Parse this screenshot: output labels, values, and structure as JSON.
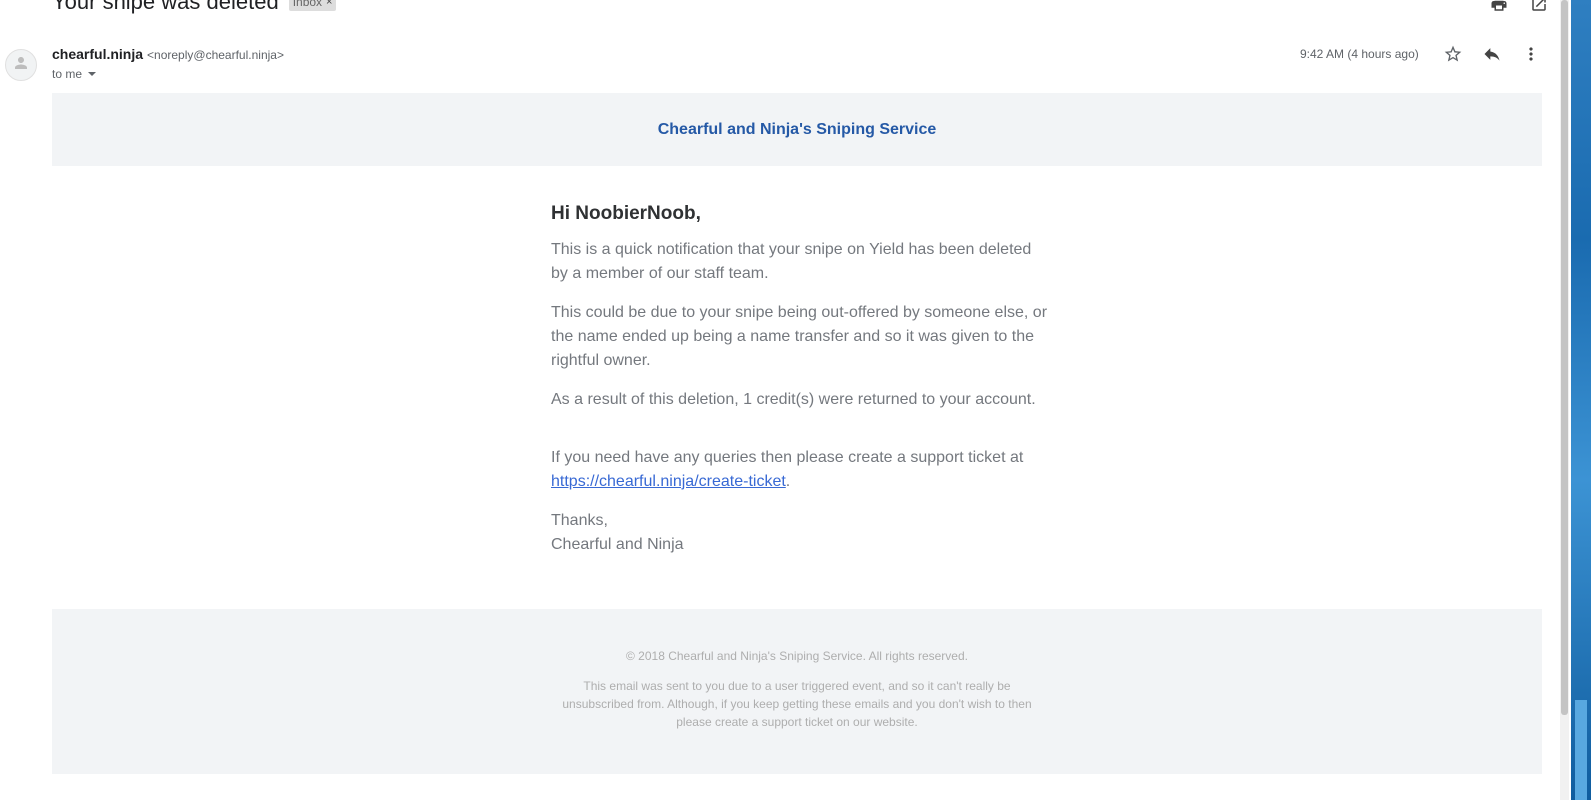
{
  "subject": {
    "title": "Your snipe was deleted",
    "label": "Inbox",
    "label_remove": "×"
  },
  "icons": {
    "print": "printer-icon",
    "new_window": "open-in-new-window-icon",
    "avatar": "person-icon",
    "star": "star-icon",
    "reply": "reply-icon",
    "more": "more-vert-icon"
  },
  "sender": {
    "name": "chearful.ninja",
    "email": "<noreply@chearful.ninja>",
    "recipient": "to me"
  },
  "meta": {
    "time": "9:42 AM (4 hours ago)"
  },
  "email": {
    "banner_title": "Chearful and Ninja's Sniping Service",
    "greeting": "Hi NoobierNoob,",
    "para1": "This is a quick notification that your snipe on Yield has been deleted by a member of our staff team.",
    "para2": "This could be due to your snipe being out-offered by someone else, or the name ended up being a name transfer and so it was given to the rightful owner.",
    "para3": "As a result of this deletion, 1 credit(s) were returned to your account.",
    "para4_text": "If you need have any queries then please create a support ticket at",
    "para4_link": "https://chearful.ninja/create-ticket",
    "para4_end": ".",
    "signoff": "Thanks,",
    "signature": "Chearful and Ninja",
    "footer_copyright": "© 2018 Chearful and Ninja's Sniping Service. All rights reserved.",
    "footer_note": "This email was sent to you due to a user triggered event, and so it can't really be unsubscribed from. Although, if you keep getting these emails and you don't wish to then please create a support ticket on our website."
  },
  "colors": {
    "banner_title": "#2559a6",
    "link": "#3869d4",
    "body_text": "#74787e",
    "banner_bg": "#f2f4f6"
  }
}
